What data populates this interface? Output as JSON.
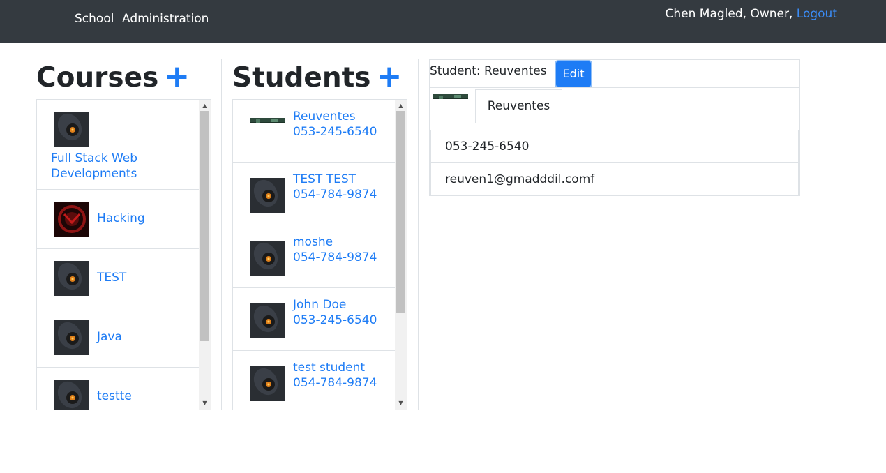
{
  "nav": {
    "links": [
      "School",
      "Administration"
    ],
    "user_text": "Chen Magled, Owner,",
    "logout_label": "Logout"
  },
  "courses": {
    "title": "Courses",
    "add_label": "+",
    "items": [
      {
        "name": "Full Stack Web Developments",
        "icon": "orange-gear-thumbnail"
      },
      {
        "name": "Hacking",
        "icon": "red-emblem-thumbnail"
      },
      {
        "name": "TEST",
        "icon": "orange-gear-thumbnail"
      },
      {
        "name": "Java",
        "icon": "orange-gear-thumbnail"
      },
      {
        "name": "testte",
        "icon": "orange-gear-thumbnail"
      }
    ]
  },
  "students": {
    "title": "Students",
    "add_label": "+",
    "items": [
      {
        "name": "Reuventes",
        "phone": "053-245-6540",
        "icon": "green-landscape-thumbnail"
      },
      {
        "name": "TEST TEST",
        "phone": "054-784-9874",
        "icon": "orange-gear-thumbnail"
      },
      {
        "name": "moshe",
        "phone": "054-784-9874",
        "icon": "orange-gear-thumbnail"
      },
      {
        "name": "John Doe",
        "phone": "053-245-6540",
        "icon": "orange-gear-thumbnail"
      },
      {
        "name": "test student",
        "phone": "054-784-9874",
        "icon": "orange-gear-thumbnail"
      }
    ]
  },
  "detail": {
    "title": "Student: Reuventes",
    "edit_label": "Edit",
    "name": "Reuventes",
    "phone": "053-245-6540",
    "email": "reuven1@gmadddil.comf"
  },
  "colors": {
    "navbar": "#343a40",
    "link": "#1e7cf5",
    "border": "#dee2e6"
  }
}
